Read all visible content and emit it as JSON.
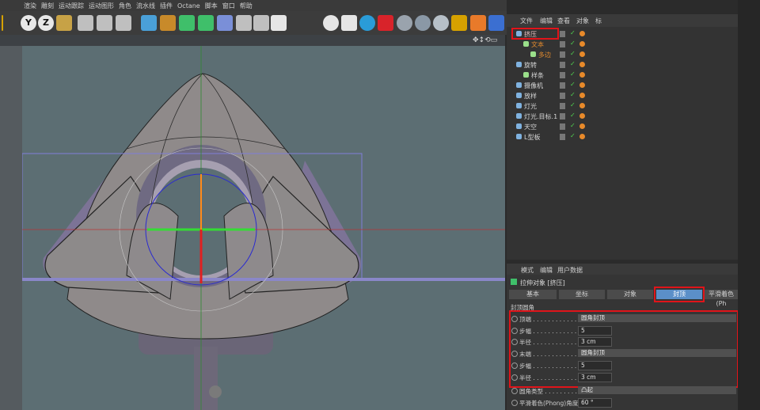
{
  "menu": [
    "渲染",
    "雕刻",
    "运动跟踪",
    "运动图形",
    "角色",
    "流水线",
    "插件",
    "Octane",
    "脚本",
    "窗口",
    "帮助"
  ],
  "toolbar": {
    "axis_y": "Y",
    "axis_z": "Z"
  },
  "object_manager": {
    "menu": [
      "文件",
      "编辑",
      "查看",
      "对象",
      "标"
    ],
    "objects": [
      {
        "name": "挤压",
        "indent": 0,
        "color": "#e9c3c3",
        "highlight": true
      },
      {
        "name": "文本",
        "indent": 1,
        "color": "#e08a2e"
      },
      {
        "name": "多边",
        "indent": 2,
        "color": "#e08a2e"
      },
      {
        "name": "旋转",
        "indent": 0,
        "color": "#d6d6d6"
      },
      {
        "name": "样条",
        "indent": 1,
        "color": "#d6d6d6"
      },
      {
        "name": "摄像机",
        "indent": 0,
        "color": "#d6d6d6"
      },
      {
        "name": "放样",
        "indent": 0,
        "color": "#d6d6d6"
      },
      {
        "name": "灯光",
        "indent": 0,
        "color": "#d6d6d6"
      },
      {
        "name": "灯光.目标.1",
        "indent": 0,
        "color": "#d6d6d6"
      },
      {
        "name": "天空",
        "indent": 0,
        "color": "#d6d6d6"
      },
      {
        "name": "L型板",
        "indent": 0,
        "color": "#d6d6d6"
      }
    ]
  },
  "attributes": {
    "menu": [
      "模式",
      "编辑",
      "用户数据"
    ],
    "object_title": "拉伸对象 [挤压]",
    "tabs": [
      "基本",
      "坐标",
      "对象",
      "封顶",
      "平滑着色(Ph"
    ],
    "active_tab": "封顶",
    "section_title": "封顶圆角",
    "params": [
      {
        "label": "顶端 . . . . . . . . . . . . . . . .",
        "value": "圆角封顶",
        "kind": "dropdown"
      },
      {
        "label": "步幅 . . . . . . . . . . . . . . . .",
        "value": "5",
        "kind": "number"
      },
      {
        "label": "半径 . . . . . . . . . . . . . . . .",
        "value": "3 cm",
        "kind": "number"
      },
      {
        "label": "末端 . . . . . . . . . . . . . . . .",
        "value": "圆角封顶",
        "kind": "dropdown"
      },
      {
        "label": "步幅 . . . . . . . . . . . . . . . .",
        "value": "5",
        "kind": "number"
      },
      {
        "label": "半径 . . . . . . . . . . . . . . . .",
        "value": "3 cm",
        "kind": "number"
      }
    ],
    "extra_params": [
      {
        "label": "圆角类型 . . . . . . . . . . . . . .",
        "value": "凸起",
        "kind": "dropdown"
      },
      {
        "label": "平滑着色(Phong)角度",
        "value": "60 °",
        "kind": "number"
      }
    ]
  },
  "colors": {
    "highlight_red": "#e0141a",
    "active_tab": "#5b8fc8",
    "viewport_bg": "#5c6e73"
  }
}
